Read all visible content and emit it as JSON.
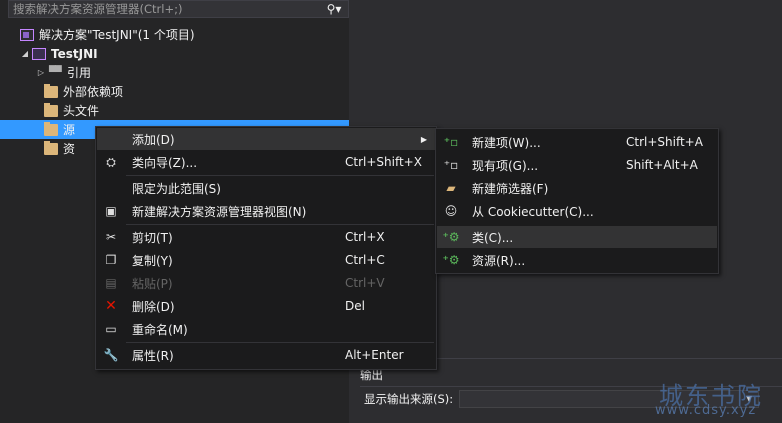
{
  "solution_explorer": {
    "search_placeholder": "搜索解决方案资源管理器(Ctrl+;)",
    "tree": [
      {
        "label": "解决方案\"TestJNI\"(1 个项目)",
        "icon": "solution-icon"
      },
      {
        "label": "TestJNI",
        "icon": "project-icon"
      },
      {
        "label": "引用",
        "icon": "references-icon"
      },
      {
        "label": "外部依赖项",
        "icon": "folder-icon"
      },
      {
        "label": "头文件",
        "icon": "folder-icon"
      },
      {
        "label": "源",
        "icon": "folder-icon",
        "selected": true
      },
      {
        "label": "资",
        "icon": "folder-icon"
      }
    ]
  },
  "context_menu": {
    "items": [
      {
        "label": "添加(D)",
        "shortcut": "",
        "icon": "",
        "has_submenu": true
      },
      {
        "label": "类向导(Z)...",
        "shortcut": "Ctrl+Shift+X",
        "icon": "class-wizard-icon"
      },
      {
        "label": "限定为此范围(S)",
        "shortcut": "",
        "icon": ""
      },
      {
        "label": "新建解决方案资源管理器视图(N)",
        "shortcut": "",
        "icon": "new-view-icon"
      },
      {
        "label": "剪切(T)",
        "shortcut": "Ctrl+X",
        "icon": "cut-icon"
      },
      {
        "label": "复制(Y)",
        "shortcut": "Ctrl+C",
        "icon": "copy-icon"
      },
      {
        "label": "粘贴(P)",
        "shortcut": "Ctrl+V",
        "icon": "paste-icon",
        "disabled": true
      },
      {
        "label": "删除(D)",
        "shortcut": "Del",
        "icon": "delete-icon"
      },
      {
        "label": "重命名(M)",
        "shortcut": "",
        "icon": "rename-icon"
      },
      {
        "label": "属性(R)",
        "shortcut": "Alt+Enter",
        "icon": "properties-icon"
      }
    ]
  },
  "submenu": {
    "items": [
      {
        "label": "新建项(W)...",
        "shortcut": "Ctrl+Shift+A",
        "icon": "new-item-icon"
      },
      {
        "label": "现有项(G)...",
        "shortcut": "Shift+Alt+A",
        "icon": "existing-item-icon"
      },
      {
        "label": "新建筛选器(F)",
        "shortcut": "",
        "icon": "new-filter-icon"
      },
      {
        "label": "从 Cookiecutter(C)...",
        "shortcut": "",
        "icon": "cookiecutter-icon"
      },
      {
        "label": "类(C)...",
        "shortcut": "",
        "icon": "class-icon"
      },
      {
        "label": "资源(R)...",
        "shortcut": "",
        "icon": "resource-icon"
      }
    ]
  },
  "output": {
    "title": "输出",
    "source_label": "显示输出来源(S):"
  },
  "watermark": {
    "line1": "城东书院",
    "line2": "www.cdsy.xyz"
  },
  "colors": {
    "selection": "#3399ff",
    "menu_bg": "#1b1b1c",
    "panel_bg": "#252526",
    "delete_red": "#e51400"
  }
}
